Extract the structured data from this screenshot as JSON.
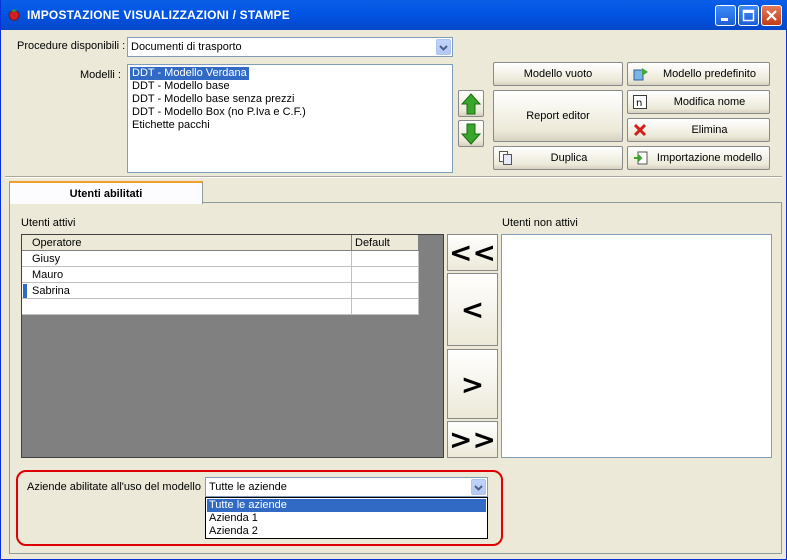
{
  "window": {
    "title": "IMPOSTAZIONE VISUALIZZAZIONI / STAMPE"
  },
  "procedure": {
    "label": "Procedure disponibili :",
    "selected": "Documenti di trasporto"
  },
  "modelli": {
    "label": "Modelli :",
    "items": [
      "DDT - Modello Verdana",
      "DDT - Modello base",
      "DDT - Modello base senza prezzi",
      "DDT - Modello Box (no P.Iva e C.F.)",
      "Etichette pacchi"
    ],
    "selected_index": 0
  },
  "buttons": {
    "modello_vuoto": "Modello vuoto",
    "modello_predefinito": "Modello predefinito",
    "report_editor": "Report editor",
    "modifica_nome": "Modifica nome",
    "elimina": "Elimina",
    "duplica": "Duplica",
    "importazione": "Importazione modello"
  },
  "tab": {
    "label": "Utenti abilitati"
  },
  "utenti_attivi": {
    "label": "Utenti attivi",
    "columns": [
      "Operatore",
      "Default"
    ],
    "rows": [
      "Giusy",
      "Mauro",
      "Sabrina"
    ]
  },
  "utenti_non_attivi": {
    "label": "Utenti non attivi"
  },
  "move_buttons": [
    "<<",
    "<",
    ">",
    ">>"
  ],
  "aziende": {
    "label": "Aziende abilitate all'uso del modello :",
    "selected": "Tutte le aziende",
    "options": [
      "Tutte le aziende",
      "Azienda 1",
      "Azienda 2"
    ]
  },
  "colors": {
    "title_bar": "#0054e3",
    "selection": "#316ac5",
    "highlight_border": "#e00000",
    "arrow_green": "#3aa52c",
    "delete_red": "#d0201a"
  }
}
